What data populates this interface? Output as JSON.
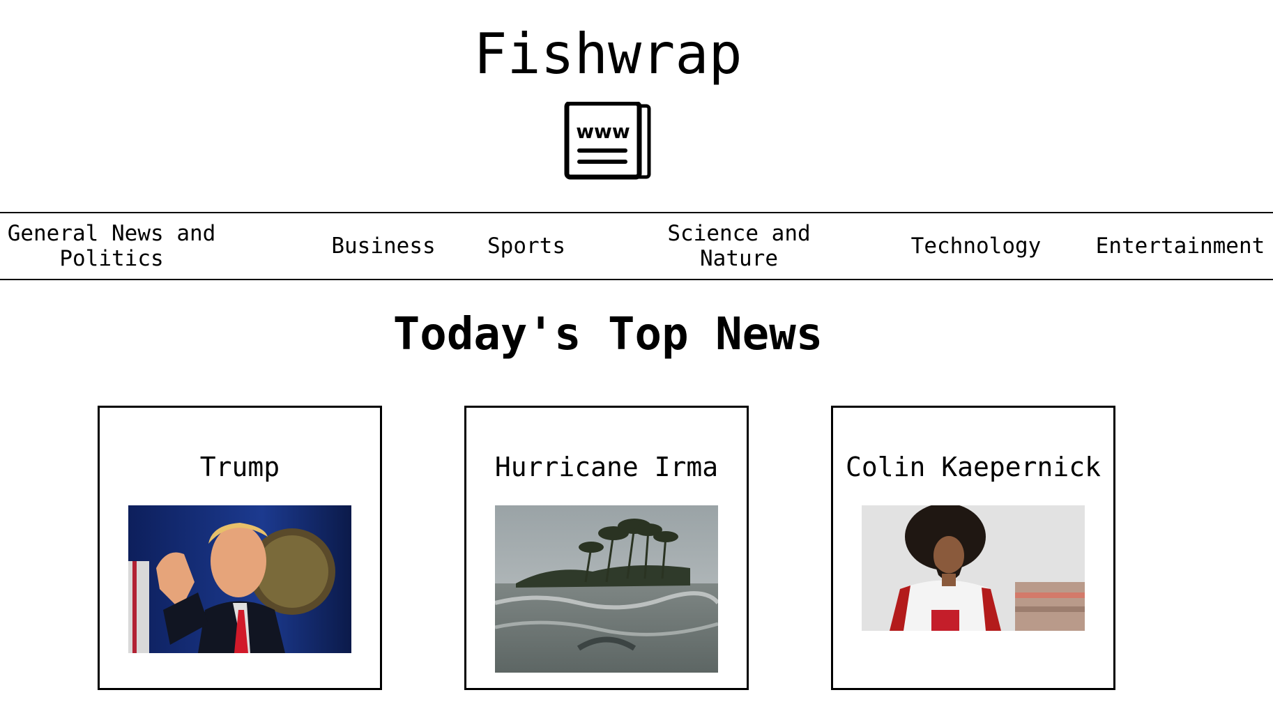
{
  "header": {
    "title": "Fishwrap",
    "logo_icon": "newspaper-www-icon",
    "logo_text": "www"
  },
  "nav": {
    "items": [
      {
        "label": "General News and\nPolitics"
      },
      {
        "label": "Business"
      },
      {
        "label": "Sports"
      },
      {
        "label": "Science and\nNature"
      },
      {
        "label": "Technology"
      },
      {
        "label": "Entertainment"
      }
    ]
  },
  "main": {
    "section_title": "Today's Top News",
    "cards": [
      {
        "title": "Trump",
        "image": "trump-photo"
      },
      {
        "title": "Hurricane Irma",
        "image": "hurricane-irma-photo"
      },
      {
        "title": "Colin Kaepernick",
        "image": "colin-kaepernick-photo"
      }
    ]
  }
}
